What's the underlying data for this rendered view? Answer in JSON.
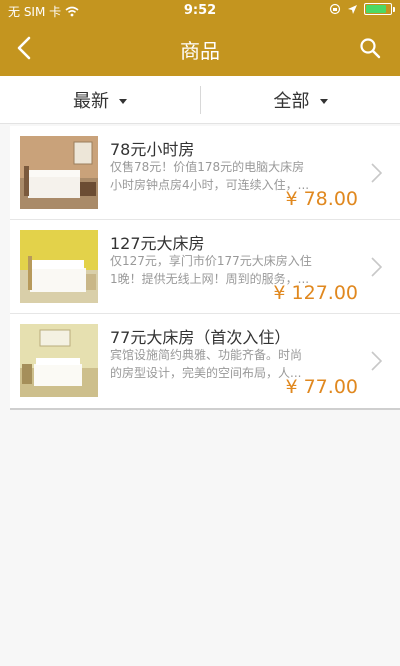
{
  "status_bar": {
    "carrier": "无 SIM 卡",
    "time": "9:52",
    "battery_fill": 0.85
  },
  "nav": {
    "title": "商品"
  },
  "filters": {
    "sort_label": "最新",
    "category_label": "全部"
  },
  "products": [
    {
      "title": "78元小时房",
      "desc_line1": "仅售78元！价值178元的电脑大床房",
      "desc_line2": "小时房钟点房4小时，可连续入住，...",
      "price": "¥ 78.00",
      "wall_color": "#c9a27a"
    },
    {
      "title": "127元大床房",
      "desc_line1": "仅127元，享门市价177元大床房入住",
      "desc_line2": "1晚！提供无线上网！周到的服务，...",
      "price": "¥ 127.00",
      "wall_color": "#e3d24a"
    },
    {
      "title": "77元大床房（首次入住）",
      "desc_line1": "宾馆设施简约典雅、功能齐备。时尚",
      "desc_line2": "的房型设计，完美的空间布局，人...",
      "price": "¥ 77.00",
      "wall_color": "#e6e0b0"
    }
  ]
}
